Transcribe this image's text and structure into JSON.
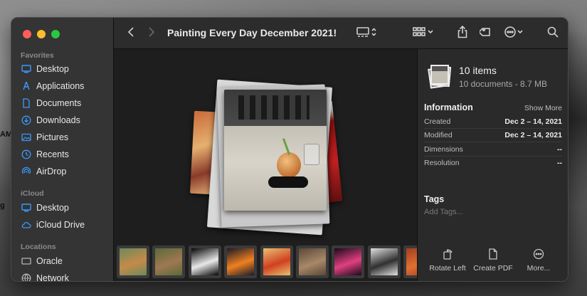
{
  "background": {
    "edge_labels": [
      "AM",
      "g"
    ]
  },
  "window": {
    "title": "Painting Every Day December 2021!"
  },
  "sidebar": {
    "sections": [
      {
        "title": "Favorites",
        "items": [
          {
            "label": "Desktop",
            "icon": "desktop-icon"
          },
          {
            "label": "Applications",
            "icon": "applications-icon"
          },
          {
            "label": "Documents",
            "icon": "document-icon"
          },
          {
            "label": "Downloads",
            "icon": "download-icon"
          },
          {
            "label": "Pictures",
            "icon": "pictures-icon"
          },
          {
            "label": "Recents",
            "icon": "clock-icon"
          },
          {
            "label": "AirDrop",
            "icon": "airdrop-icon"
          }
        ]
      },
      {
        "title": "iCloud",
        "items": [
          {
            "label": "Desktop",
            "icon": "desktop-icon"
          },
          {
            "label": "iCloud Drive",
            "icon": "cloud-icon"
          }
        ]
      },
      {
        "title": "Locations",
        "items": [
          {
            "label": "Oracle",
            "icon": "drive-icon"
          },
          {
            "label": "Network",
            "icon": "globe-icon"
          }
        ]
      }
    ]
  },
  "toolbar": {
    "buttons": [
      "back-icon",
      "forward-icon",
      "gallery-view-icon",
      "group-icon",
      "share-icon",
      "tag-icon",
      "more-icon",
      "search-icon"
    ]
  },
  "inspector": {
    "items_title": "10 items",
    "items_subtitle": "10 documents - 8.7 MB",
    "information_heading": "Information",
    "show_more": "Show More",
    "rows": [
      {
        "key": "Created",
        "value": "Dec 2 – 14, 2021"
      },
      {
        "key": "Modified",
        "value": "Dec 2 – 14, 2021"
      },
      {
        "key": "Dimensions",
        "value": "--"
      },
      {
        "key": "Resolution",
        "value": "--"
      }
    ],
    "tags_heading": "Tags",
    "tags_placeholder": "Add Tags...",
    "actions": [
      {
        "label": "Rotate Left",
        "icon": "rotate-left-icon"
      },
      {
        "label": "Create PDF",
        "icon": "create-pdf-icon"
      },
      {
        "label": "More...",
        "icon": "more-icon"
      }
    ]
  },
  "colors": {
    "accent": "#3b99fc",
    "window_bg": "#1e1e1e",
    "sidebar_bg": "#343434",
    "inspector_bg": "#2a2a2a"
  },
  "filmstrip": {
    "thumbnails": [
      {
        "name": "deer painting",
        "colors": [
          "#6d8a5a",
          "#c58a4a"
        ]
      },
      {
        "name": "animal painting",
        "colors": [
          "#5a6a3a",
          "#a07850"
        ]
      },
      {
        "name": "dark portrait",
        "colors": [
          "#050505",
          "#e8e8e8"
        ]
      },
      {
        "name": "sunset landscape",
        "colors": [
          "#1a1a2a",
          "#f08020"
        ]
      },
      {
        "name": "dancer figure",
        "colors": [
          "#e8c070",
          "#d04020"
        ]
      },
      {
        "name": "canyon landscape",
        "colors": [
          "#5a4838",
          "#a88868"
        ]
      },
      {
        "name": "ballerina",
        "colors": [
          "#1a0a1a",
          "#e04080"
        ]
      },
      {
        "name": "dancer sketch",
        "colors": [
          "#e0e0e0",
          "#303030"
        ]
      },
      {
        "name": "flowers",
        "colors": [
          "#a04020",
          "#e07030"
        ]
      }
    ]
  }
}
